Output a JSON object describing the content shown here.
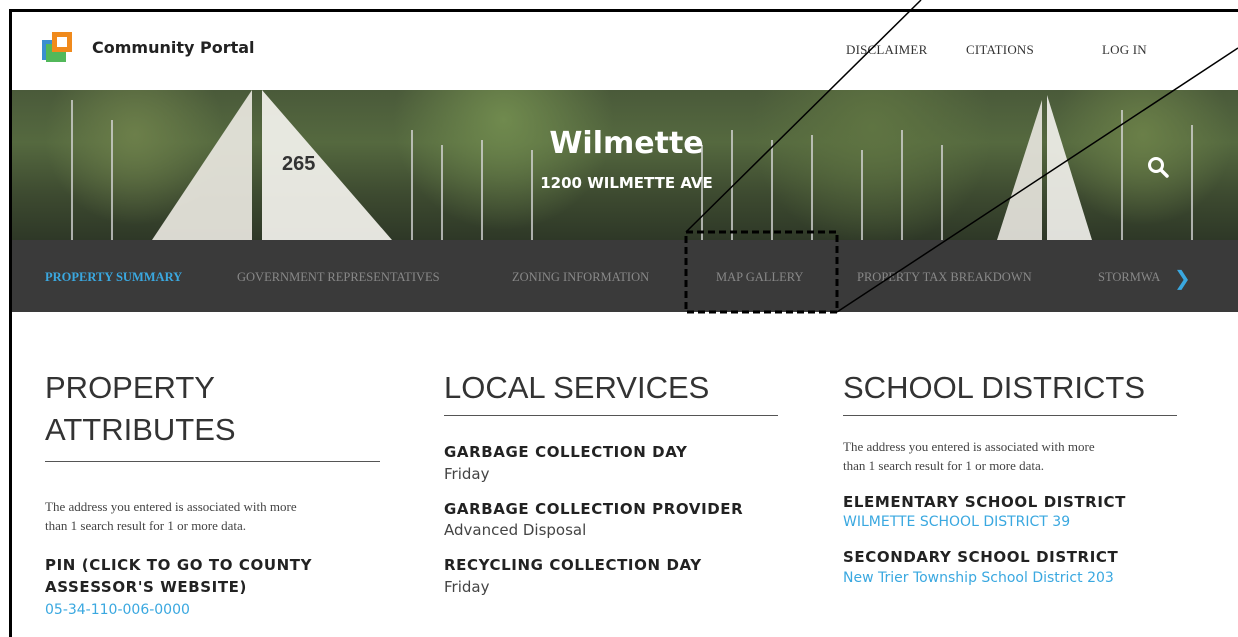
{
  "header": {
    "brand": "Community Portal",
    "nav": [
      "DISCLAIMER",
      "CITATIONS",
      "LOG IN"
    ]
  },
  "hero": {
    "title": "Wilmette",
    "address": "1200 WILMETTE AVE",
    "sail_number": "265"
  },
  "tabs": [
    {
      "label": "PROPERTY SUMMARY",
      "active": true
    },
    {
      "label": "GOVERNMENT REPRESENTATIVES",
      "active": false
    },
    {
      "label": "ZONING INFORMATION",
      "active": false
    },
    {
      "label": "MAP GALLERY",
      "active": false
    },
    {
      "label": "PROPERTY TAX BREAKDOWN",
      "active": false
    },
    {
      "label": "STORMWA",
      "active": false
    }
  ],
  "columns": {
    "property": {
      "heading_line1": "PROPERTY",
      "heading_line2": "ATTRIBUTES",
      "note_line1": "The address you entered is associated with more",
      "note_line2": "than 1 search result for 1 or more data.",
      "pin_label_line1": "PIN (CLICK TO GO TO COUNTY",
      "pin_label_line2": "ASSESSOR'S WEBSITE)",
      "pin_value": "05-34-110-006-0000"
    },
    "local": {
      "heading": "LOCAL SERVICES",
      "items": [
        {
          "label": "GARBAGE COLLECTION DAY",
          "value": "Friday"
        },
        {
          "label": "GARBAGE COLLECTION PROVIDER",
          "value": "Advanced Disposal"
        },
        {
          "label": "RECYCLING COLLECTION DAY",
          "value": "Friday"
        }
      ]
    },
    "school": {
      "heading": "SCHOOL DISTRICTS",
      "note_line1": "The address you entered is associated with more",
      "note_line2": "than 1 search result for 1 or more data.",
      "items": [
        {
          "label": "ELEMENTARY SCHOOL DISTRICT",
          "value": "WILMETTE SCHOOL DISTRICT 39"
        },
        {
          "label": "SECONDARY SCHOOL DISTRICT",
          "value": "New Trier Township School District 203"
        }
      ]
    }
  },
  "colors": {
    "accent": "#3aa8e0",
    "tabbar": "#3a3a3a",
    "text": "#333333"
  },
  "icons": [
    "search-icon",
    "chevron-right-icon",
    "logo-icon"
  ]
}
